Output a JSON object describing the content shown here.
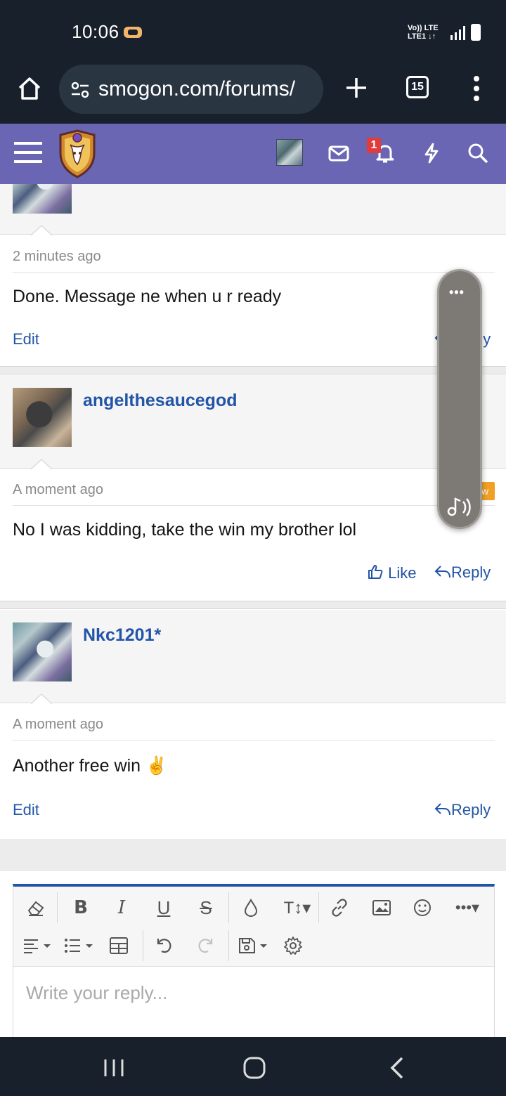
{
  "status": {
    "time": "10:06",
    "network": "Vo)) LTE\nLTE1 ↓↑"
  },
  "browser": {
    "url": "smogon.com/forums/",
    "tab_count": "15"
  },
  "site": {
    "notifications_count": "1"
  },
  "posts": [
    {
      "time": "2 minutes ago",
      "text": "Done. Message ne when u r ready",
      "edit_label": "Edit",
      "reply_label": "Reply"
    },
    {
      "username": "angelthesaucegod",
      "time": "A moment ago",
      "badge": "w",
      "text": "No I was kidding, take the win my brother lol",
      "like_label": "Like",
      "reply_label": "Reply"
    },
    {
      "username": "Nkc1201*",
      "time": "A moment ago",
      "text": "Another free win ✌️",
      "edit_label": "Edit",
      "reply_label": "Reply"
    }
  ],
  "editor": {
    "placeholder": "Write your reply..."
  },
  "floating": {
    "dots": "•••"
  }
}
